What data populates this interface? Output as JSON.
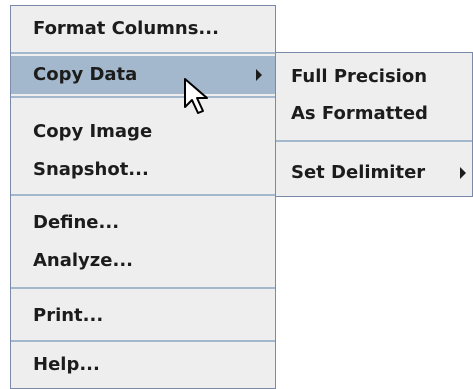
{
  "main_menu": {
    "items": [
      {
        "label": "Format Columns..."
      },
      {
        "label": "Copy Data",
        "has_submenu": true,
        "active": true
      },
      {
        "label": "Copy Image"
      },
      {
        "label": "Snapshot..."
      },
      {
        "label": "Define..."
      },
      {
        "label": "Analyze..."
      },
      {
        "label": "Print..."
      },
      {
        "label": "Help..."
      }
    ]
  },
  "sub_menu": {
    "items": [
      {
        "label": "Full Precision"
      },
      {
        "label": "As Formatted"
      },
      {
        "label": "Set Delimiter",
        "has_submenu": true
      }
    ]
  },
  "icons": {
    "submenu_arrow": "triangle-right-icon",
    "cursor": "arrow-pointer-icon"
  },
  "colors": {
    "menu_background": "#eeeeee",
    "highlight": "#a3b8cc",
    "border": "#7a8aa8",
    "text": "#1c1c1c"
  }
}
